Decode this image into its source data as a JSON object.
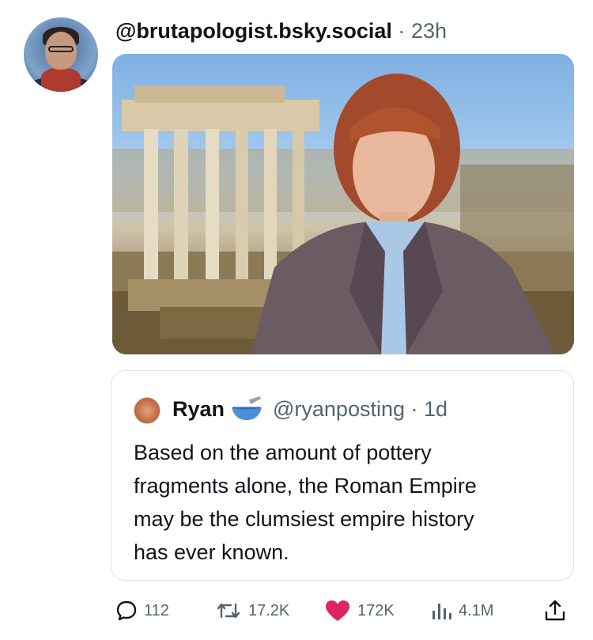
{
  "post": {
    "author_handle": "@brutapologist.bsky.social",
    "separator": "·",
    "time": "23h"
  },
  "quoted": {
    "name": "Ryan",
    "badge_icon": "bowl-with-spoon-icon",
    "handle": "@ryanposting",
    "separator": "·",
    "time": "1d",
    "text_lines": [
      "Based on the amount of pottery",
      "fragments alone, the Roman Empire",
      "may be the clumsiest empire history",
      "has ever known."
    ]
  },
  "actions": {
    "replies": "112",
    "reposts": "17.2K",
    "likes": "172K",
    "views": "4.1M"
  },
  "colors": {
    "like": "#e0245e",
    "muted": "#536471",
    "text": "#0f1419",
    "border": "#dfe3e7"
  }
}
